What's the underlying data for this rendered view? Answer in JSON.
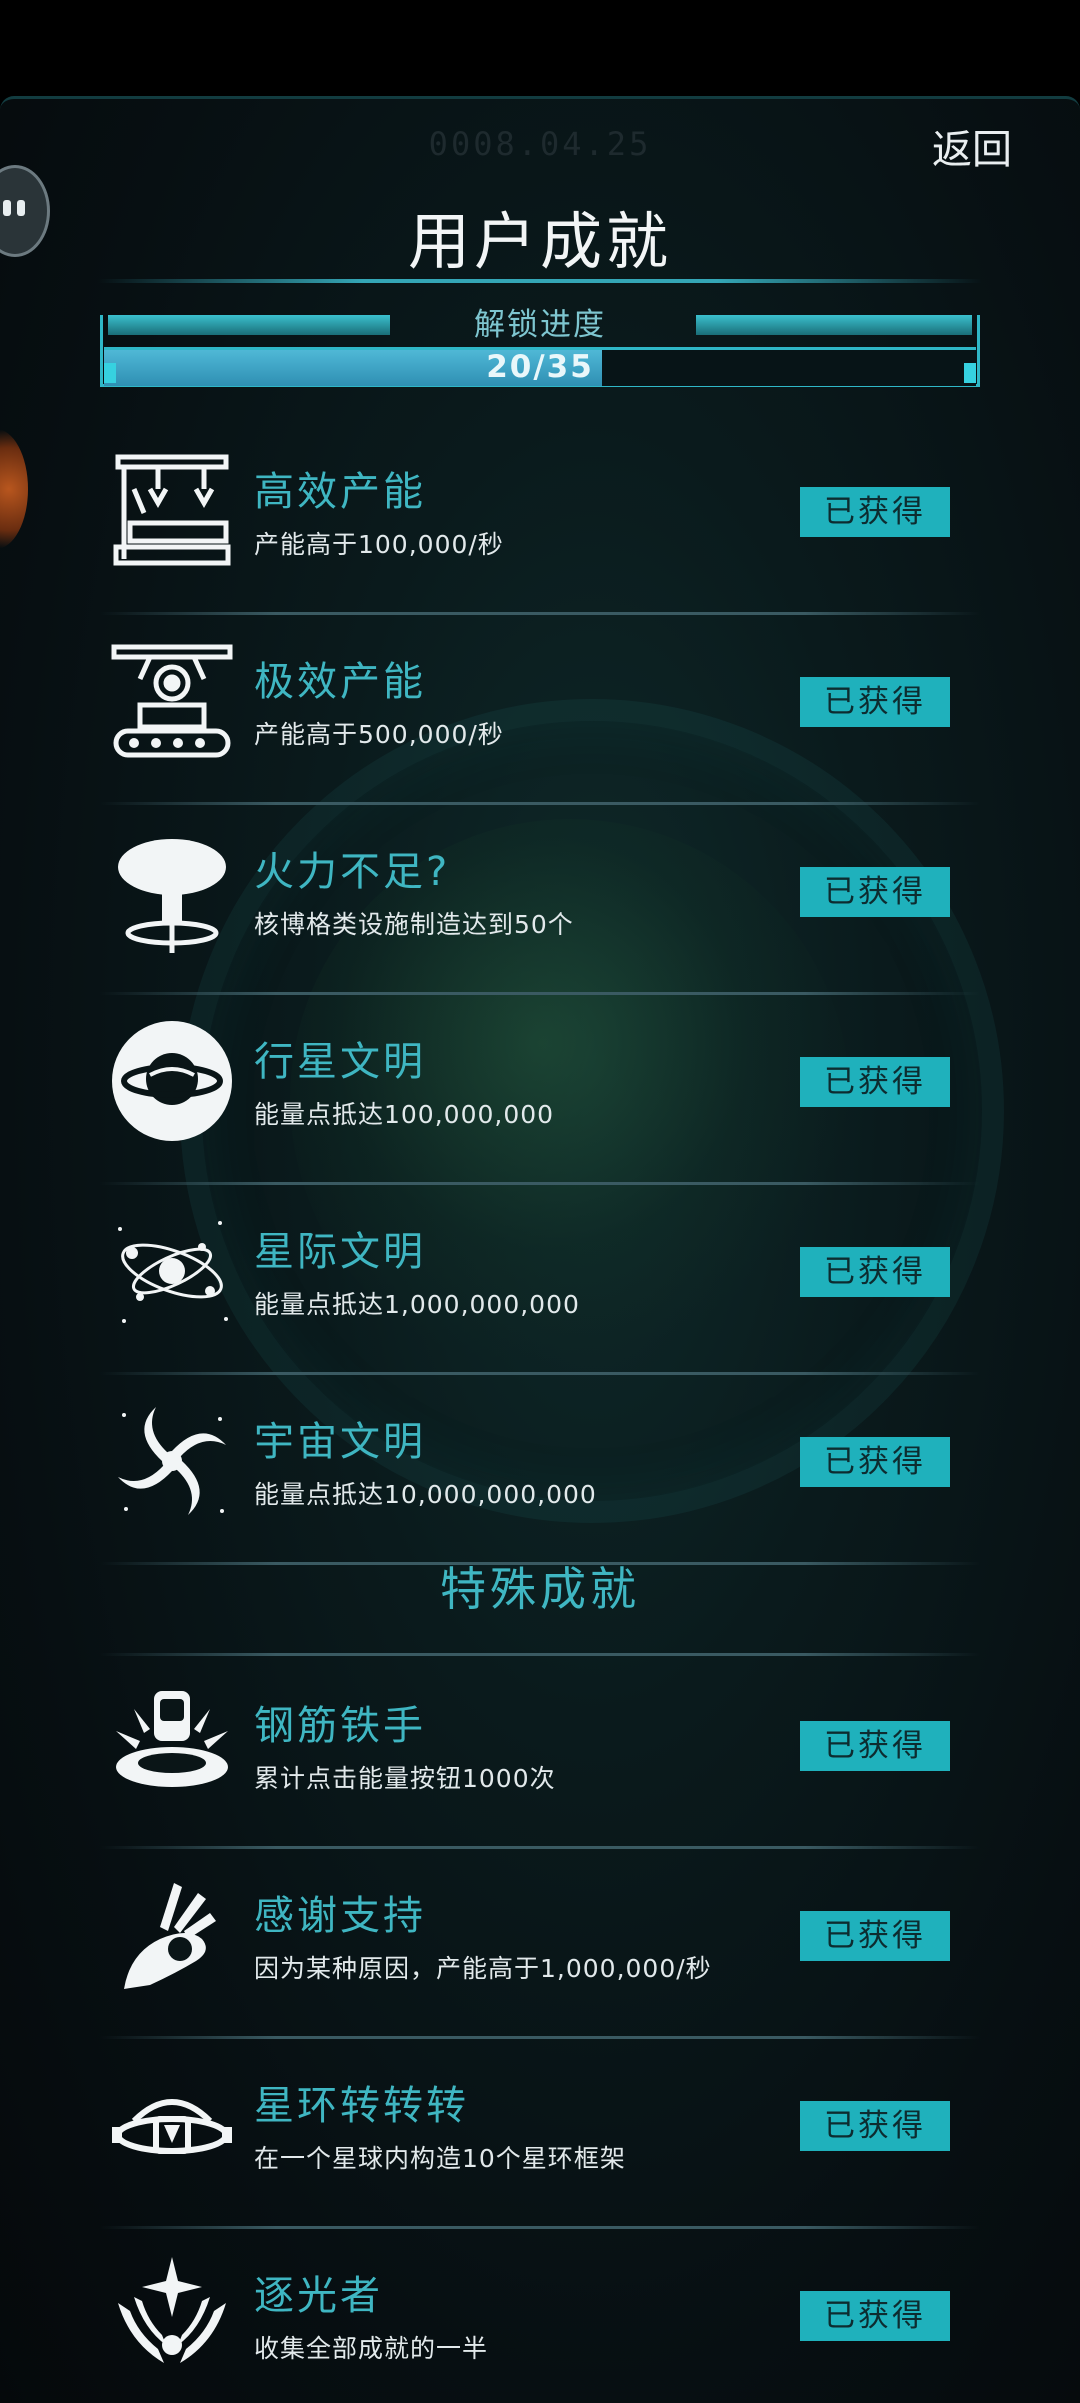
{
  "header": {
    "date": "0008.04.25",
    "back_label": "返回",
    "title": "用户成就"
  },
  "progress": {
    "label": "解锁进度",
    "unlocked": 20,
    "total": 35,
    "count_text": "20/35"
  },
  "achievements": [
    {
      "name": "高效产能",
      "desc": "产能高于100,000/秒",
      "status": "已获得",
      "icon": "factory-robot-arm-icon"
    },
    {
      "name": "极效产能",
      "desc": "产能高于500,000/秒",
      "status": "已获得",
      "icon": "gear-conveyor-icon"
    },
    {
      "name": "火力不足?",
      "desc": "核博格类设施制造达到50个",
      "status": "已获得",
      "icon": "mushroom-cloud-icon"
    },
    {
      "name": "行星文明",
      "desc": "能量点抵达100,000,000",
      "status": "已获得",
      "icon": "ringed-planet-icon"
    },
    {
      "name": "星际文明",
      "desc": "能量点抵达1,000,000,000",
      "status": "已获得",
      "icon": "solar-system-icon"
    },
    {
      "name": "宇宙文明",
      "desc": "能量点抵达10,000,000,000",
      "status": "已获得",
      "icon": "spiral-galaxy-icon"
    }
  ],
  "special_section": {
    "title": "特殊成就"
  },
  "special_achievements": [
    {
      "name": "钢筋铁手",
      "desc": "累计点击能量按钮1000次",
      "status": "已获得",
      "icon": "press-button-icon"
    },
    {
      "name": "感谢支持",
      "desc": "因为某种原因，产能高于1,000,000/秒",
      "status": "已获得",
      "icon": "ok-hand-icon"
    },
    {
      "name": "星环转转转",
      "desc": "在一个星球内构造10个星环框架",
      "status": "已获得",
      "icon": "ring-frame-icon"
    },
    {
      "name": "逐光者",
      "desc": "收集全部成就的一半",
      "status": "已获得",
      "icon": "winged-star-icon"
    }
  ],
  "colors": {
    "accent": "#3fb6c2",
    "badge": "#1fb1bc",
    "progress_fill": "#2f8fb3"
  }
}
